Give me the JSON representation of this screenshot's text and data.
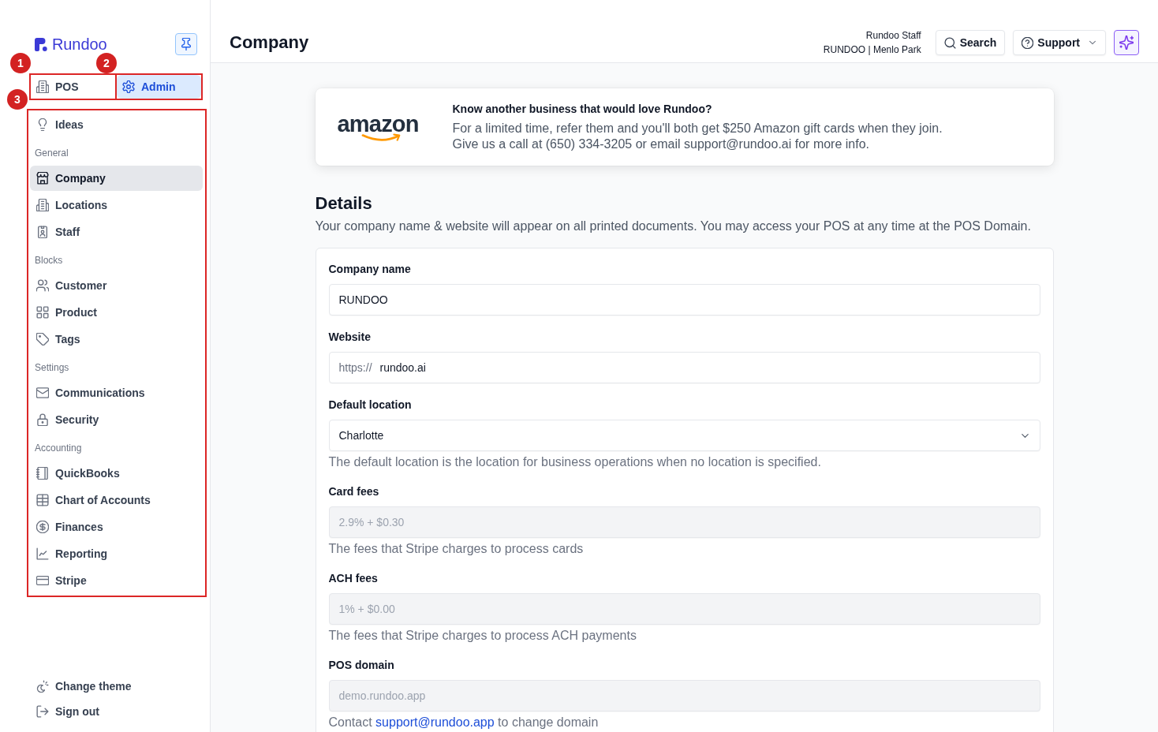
{
  "sidebar": {
    "brand": "Rundoo",
    "mode_tabs": [
      {
        "label": "POS",
        "selected": false,
        "marker": "1"
      },
      {
        "label": "Admin",
        "selected": true,
        "marker": "2"
      }
    ],
    "nav": {
      "marker": "3",
      "sections": [
        {
          "items": [
            {
              "label": "Ideas",
              "selected": false
            }
          ]
        },
        {
          "heading": "General",
          "items": [
            {
              "label": "Company",
              "selected": true
            },
            {
              "label": "Locations",
              "selected": false
            },
            {
              "label": "Staff",
              "selected": false
            }
          ]
        },
        {
          "heading": "Blocks",
          "items": [
            {
              "label": "Customer",
              "selected": false
            },
            {
              "label": "Product",
              "selected": false
            },
            {
              "label": "Tags",
              "selected": false
            }
          ]
        },
        {
          "heading": "Settings",
          "items": [
            {
              "label": "Communications",
              "selected": false
            },
            {
              "label": "Security",
              "selected": false
            }
          ]
        },
        {
          "heading": "Accounting",
          "items": [
            {
              "label": "QuickBooks",
              "selected": false
            },
            {
              "label": "Chart of Accounts",
              "selected": false
            },
            {
              "label": "Finances",
              "selected": false
            },
            {
              "label": "Reporting",
              "selected": false
            },
            {
              "label": "Stripe",
              "selected": false
            }
          ]
        }
      ]
    },
    "footer_actions": [
      {
        "label": "Change theme"
      },
      {
        "label": "Sign out"
      }
    ]
  },
  "header": {
    "title": "Company",
    "account": {
      "name": "Rundoo Staff",
      "location": "RUNDOO | Menlo Park"
    },
    "search_button": "Search",
    "support_button": "Support"
  },
  "banner": {
    "logo": "amazon",
    "title": "Know another business that would love Rundoo?",
    "lines": [
      "For a limited time, refer them and you'll both get $250 Amazon gift cards when they join.",
      "Give us a call at (650) 334-3205 or email support@rundoo.ai for more info."
    ]
  },
  "details": {
    "title": "Details",
    "description": "Your company name & website will appear on all printed documents. You may access your POS at any time at the POS Domain."
  },
  "form": {
    "fields": [
      {
        "kind": "text",
        "label": "Company name",
        "value": "RUNDOO",
        "disabled": false
      },
      {
        "kind": "url",
        "label": "Website",
        "prefix": "https://",
        "value": "rundoo.ai",
        "disabled": false
      },
      {
        "kind": "select",
        "label": "Default location",
        "value": "Charlotte",
        "disabled": false,
        "help": "The default location is the location for business operations when no location is specified."
      },
      {
        "kind": "text",
        "label": "Card fees",
        "value": "2.9% + $0.30",
        "disabled": true,
        "help": "The fees that Stripe charges to process cards"
      },
      {
        "kind": "text",
        "label": "ACH fees",
        "value": "1% + $0.00",
        "disabled": true,
        "help": "The fees that Stripe charges to process ACH payments"
      },
      {
        "kind": "text",
        "label": "POS domain",
        "value": "demo.rundoo.app",
        "disabled": true,
        "help": "Contact",
        "help_link": "support@rundoo.app",
        "help_after": "to change domain"
      }
    ]
  }
}
